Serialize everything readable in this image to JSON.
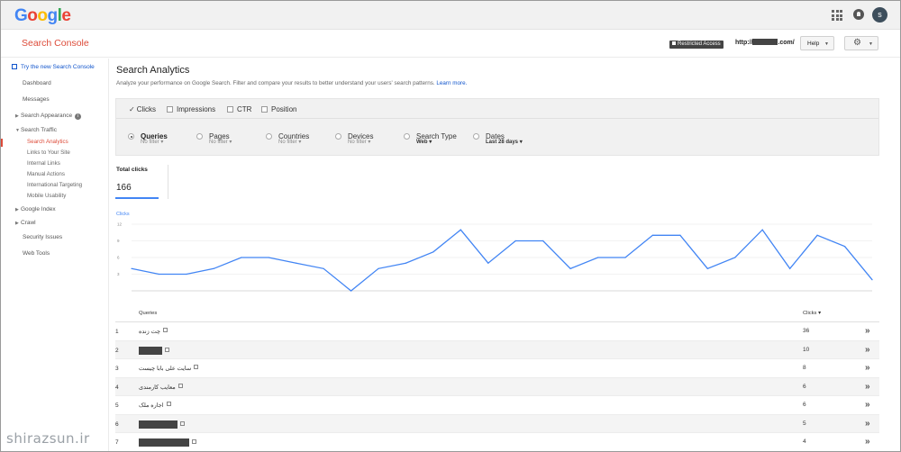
{
  "topbar": {
    "logo": [
      "G",
      "o",
      "o",
      "g",
      "l",
      "e"
    ],
    "logo_colors": [
      "#4285f4",
      "#ea4335",
      "#fbbc05",
      "#4285f4",
      "#34a853",
      "#ea4335"
    ],
    "avatar_initial": "s"
  },
  "header": {
    "product": "Search Console",
    "restricted": "Restricted Access",
    "site_prefix": "http://",
    "site_suffix": ".com/",
    "help": "Help"
  },
  "sidebar": {
    "try_new": "Try the new Search Console",
    "items": [
      {
        "label": "Dashboard"
      },
      {
        "label": "Messages"
      },
      {
        "label": "Search Appearance"
      },
      {
        "label": "Search Traffic"
      },
      {
        "label": "Search Analytics"
      },
      {
        "label": "Links to Your Site"
      },
      {
        "label": "Internal Links"
      },
      {
        "label": "Manual Actions"
      },
      {
        "label": "International Targeting"
      },
      {
        "label": "Mobile Usability"
      },
      {
        "label": "Google Index"
      },
      {
        "label": "Crawl"
      },
      {
        "label": "Security Issues"
      },
      {
        "label": "Web Tools"
      }
    ]
  },
  "main": {
    "title": "Search Analytics",
    "description": "Analyze your performance on Google Search. Filter and compare your results to better understand your users' search patterns.",
    "learn_more": "Learn more."
  },
  "metrics": [
    {
      "label": "Clicks",
      "checked": true
    },
    {
      "label": "Impressions",
      "checked": false
    },
    {
      "label": "CTR",
      "checked": false
    },
    {
      "label": "Position",
      "checked": false
    }
  ],
  "dimensions": [
    {
      "label": "Queries",
      "sub": "No filter",
      "selected": true
    },
    {
      "label": "Pages",
      "sub": "No filter",
      "selected": false
    },
    {
      "label": "Countries",
      "sub": "No filter",
      "selected": false
    },
    {
      "label": "Devices",
      "sub": "No filter",
      "selected": false
    },
    {
      "label": "Search Type",
      "sub": "Web",
      "selected": false
    },
    {
      "label": "Dates",
      "sub": "Last 28 days",
      "selected": false
    }
  ],
  "total": {
    "label": "Total clicks",
    "value": "166"
  },
  "chart_data": {
    "type": "line",
    "title": "",
    "ylabel": "Clicks",
    "ylim": [
      0,
      12
    ],
    "yticks": [
      "12",
      "9",
      "6",
      "3"
    ],
    "series": [
      {
        "name": "Clicks",
        "color": "#4285f4",
        "values": [
          4,
          3,
          3,
          4,
          6,
          6,
          5,
          4,
          0,
          4,
          5,
          7,
          11,
          5,
          9,
          9,
          4,
          6,
          6,
          10,
          10,
          4,
          6,
          11,
          4,
          10,
          8,
          2
        ]
      }
    ]
  },
  "table": {
    "col_query": "Queries",
    "col_clicks": "Clicks ▾",
    "rows": [
      {
        "num": "1",
        "query": "چت زنده",
        "clicks": "36"
      },
      {
        "num": "2",
        "query": "",
        "clicks": "10"
      },
      {
        "num": "3",
        "query": "سایت علی بابا چیست",
        "clicks": "8"
      },
      {
        "num": "4",
        "query": "معایب کارمندی",
        "clicks": "6"
      },
      {
        "num": "5",
        "query": "اجاره ملک",
        "clicks": "6"
      },
      {
        "num": "6",
        "query": "",
        "clicks": "5"
      },
      {
        "num": "7",
        "query": "",
        "clicks": "4"
      }
    ]
  },
  "watermark": "shirazsun.ir"
}
